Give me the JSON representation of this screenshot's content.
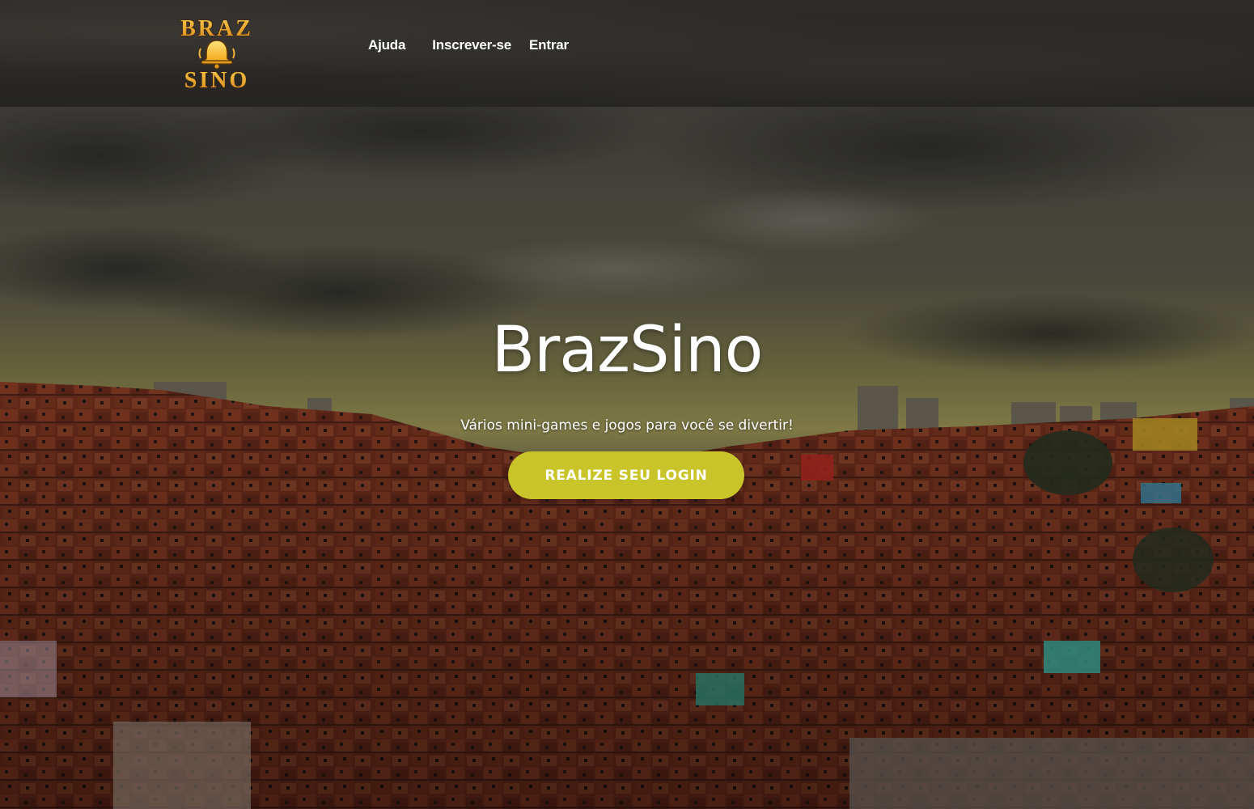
{
  "header": {
    "logo": {
      "line1": "BRAZ",
      "line2": "SINO",
      "icon": "bell-icon"
    },
    "nav": [
      {
        "label": "Ajuda"
      },
      {
        "label": "Inscrever-se"
      },
      {
        "label": "Entrar"
      }
    ]
  },
  "hero": {
    "title": "BrazSino",
    "subtitle": "Vários mini-games e jogos para você se divertir!",
    "cta_label": "REALIZE SEU LOGIN",
    "background": "favela-cityscape-photo"
  },
  "colors": {
    "navbar_bg": "#2b2926",
    "cta_bg": "#c9c42a",
    "text": "#ffffff",
    "logo_gold": "#e8a92a"
  }
}
